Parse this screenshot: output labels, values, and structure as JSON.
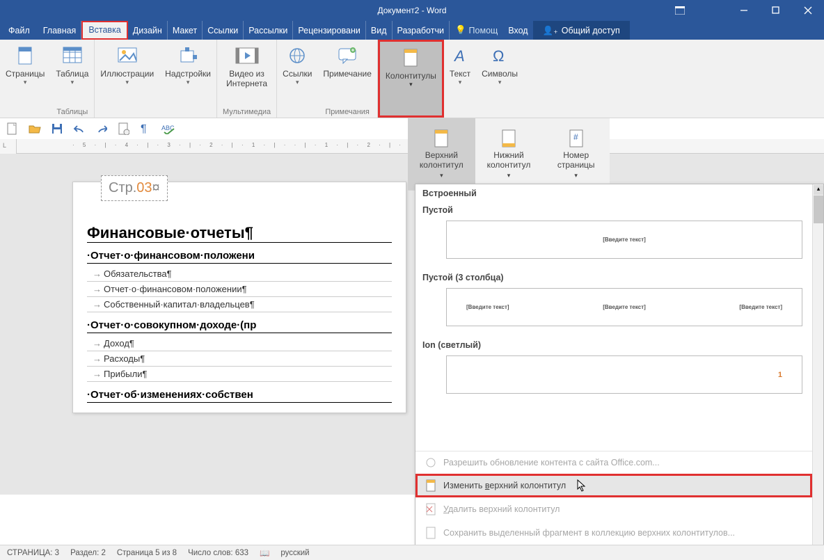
{
  "title": "Документ2 - Word",
  "tabs": {
    "file": "Файл",
    "home": "Главная",
    "insert": "Вставка",
    "design": "Дизайн",
    "layout": "Макет",
    "references": "Ссылки",
    "mailings": "Рассылки",
    "review": "Рецензировани",
    "view": "Вид",
    "developer": "Разработчи",
    "help": "Помощ",
    "signin": "Вход",
    "share": "Общий доступ"
  },
  "ribbon": {
    "pages": "Страницы",
    "table": "Таблица",
    "tables_cat": "Таблицы",
    "illustrations": "Иллюстрации",
    "addins": "Надстройки",
    "video": "Видео из\nИнтернета",
    "multimedia_cat": "Мультимедиа",
    "links": "Ссылки",
    "comment": "Примечание",
    "comments_cat": "Примечания",
    "headerfooter": "Колонтитулы",
    "text": "Текст",
    "symbols": "Символы"
  },
  "hf": {
    "header": "Верхний\nколонтитул",
    "footer": "Нижний\nколонтитул",
    "pagenum": "Номер\nстраницы"
  },
  "gallery": {
    "builtin": "Встроенный",
    "blank": "Пустой",
    "blank3": "Пустой (3 столбца)",
    "ion_light": "Ion (светлый)",
    "placeholder": "[Введите текст]",
    "ion_num": "1",
    "office_update": "Разрешить обновление контента с сайта Office.com...",
    "edit": "Изменить верхний колонтитул",
    "edit_u": "в",
    "remove": "Удалить верхний колонтитул",
    "remove_u": "У",
    "save_sel": "Сохранить выделенный фрагмент в коллекцию верхних колонтитулов..."
  },
  "doc": {
    "hdr_pre": "Стр.",
    "hdr_num": "03",
    "hdr_mark": "¤",
    "h1": "Финансовые·отчеты¶",
    "s1": "Отчет·о·финансовом·положени",
    "s1_i1": "Обязательства¶",
    "s1_i2": "Отчет·о·финансовом·положении¶",
    "s1_i3": "Собственный·капитал·владельцев¶",
    "s2": "Отчет·о·совокупном·доходе·(пр",
    "s2_i1": "Доход¶",
    "s2_i2": "Расходы¶",
    "s2_i3": "Прибыли¶",
    "s3": "Отчет·об·изменениях·собствен"
  },
  "status": {
    "page": "СТРАНИЦА: 3",
    "section": "Раздел: 2",
    "pageof": "Страница 5 из 8",
    "words": "Число слов: 633",
    "lang": "русский"
  },
  "ruler": "· 5 · | · 4 · | · 3 · | · 2 · | · 1 · | ·   · | · 1 · | · 2 · | · 3 · | · 4 · | · 5 ·"
}
